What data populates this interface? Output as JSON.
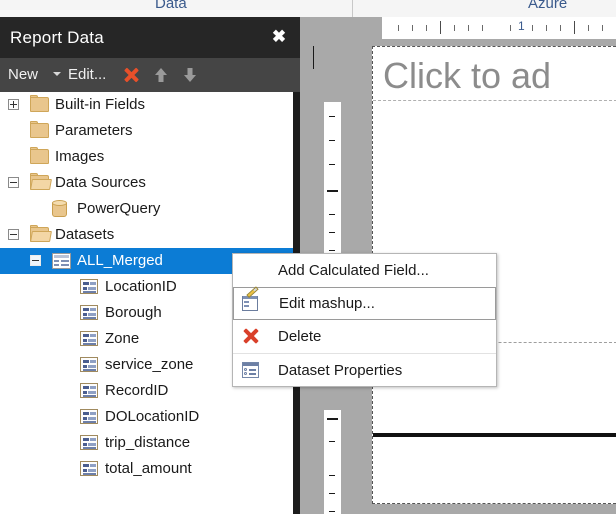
{
  "ribbon": {
    "tabs": [
      {
        "label": "Data",
        "name": "ribbon-tab-data"
      },
      {
        "label": "Azure",
        "name": "ribbon-tab-azure"
      }
    ]
  },
  "panel": {
    "title": "Report Data",
    "close_label": "✖",
    "toolbar": {
      "new_label": "New",
      "edit_label": "Edit...",
      "delete_icon": "red-x-icon",
      "move_up_icon": "arrow-up-icon",
      "move_down_icon": "arrow-down-icon"
    },
    "tree": [
      {
        "label": "Built-in Fields",
        "icon": "folder-closed-icon",
        "expander": "plus",
        "indent": 0
      },
      {
        "label": "Parameters",
        "icon": "folder-closed-icon",
        "expander": "none",
        "indent": 0
      },
      {
        "label": "Images",
        "icon": "folder-closed-icon",
        "expander": "none",
        "indent": 0
      },
      {
        "label": "Data Sources",
        "icon": "folder-open-icon",
        "expander": "minus",
        "indent": 0
      },
      {
        "label": "PowerQuery",
        "icon": "database-icon",
        "expander": "none",
        "indent": 1
      },
      {
        "label": "Datasets",
        "icon": "folder-open-icon",
        "expander": "minus",
        "indent": 0
      },
      {
        "label": "ALL_Merged",
        "icon": "dataset-icon",
        "expander": "minus",
        "indent": 1,
        "selected": true
      },
      {
        "label": "LocationID",
        "icon": "field-icon",
        "expander": "none",
        "indent": 2
      },
      {
        "label": "Borough",
        "icon": "field-icon",
        "expander": "none",
        "indent": 2
      },
      {
        "label": "Zone",
        "icon": "field-icon",
        "expander": "none",
        "indent": 2
      },
      {
        "label": "service_zone",
        "icon": "field-icon",
        "expander": "none",
        "indent": 2
      },
      {
        "label": "RecordID",
        "icon": "field-icon",
        "expander": "none",
        "indent": 2
      },
      {
        "label": "DOLocationID",
        "icon": "field-icon",
        "expander": "none",
        "indent": 2
      },
      {
        "label": "trip_distance",
        "icon": "field-icon",
        "expander": "none",
        "indent": 2
      },
      {
        "label": "total_amount",
        "icon": "field-icon",
        "expander": "none",
        "indent": 2
      }
    ]
  },
  "context_menu": {
    "items": [
      {
        "label": "Add Calculated Field...",
        "icon": "none",
        "hover": false,
        "divider": false
      },
      {
        "label": "Edit mashup...",
        "icon": "edit-mashup-icon",
        "hover": true,
        "divider": true
      },
      {
        "label": "Delete",
        "icon": "delete-icon",
        "hover": false,
        "divider": false
      },
      {
        "label": "Dataset Properties",
        "icon": "properties-icon",
        "hover": false,
        "divider": true
      }
    ]
  },
  "design_surface": {
    "title_placeholder": "Click to ad",
    "horizontal_ruler": {
      "unit_labels": [
        "1"
      ]
    },
    "vertical_ruler": {
      "unit_labels": []
    }
  },
  "colors": {
    "panel_titlebar": "#262626",
    "panel_toolbar": "#454545",
    "selection": "#0c7cd5",
    "folder": "#e9c68d",
    "delete_red": "#d9402a",
    "ribbon_text": "#3a5a8c",
    "canvas_gray": "#a9a9a9",
    "page_shadow": "#6e6e6e"
  }
}
